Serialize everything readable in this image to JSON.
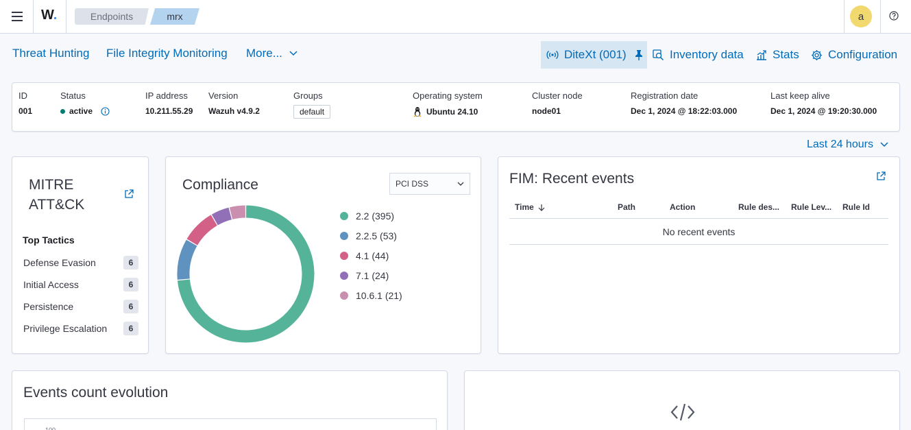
{
  "header": {
    "logo_text": "W",
    "breadcrumbs": [
      "Endpoints",
      "mrx"
    ],
    "avatar_letter": "a"
  },
  "nav": {
    "left": [
      "Threat Hunting",
      "File Integrity Monitoring",
      "More..."
    ],
    "agent_button": "DiteXt (001)",
    "right": [
      "Inventory data",
      "Stats",
      "Configuration"
    ]
  },
  "agent_info": {
    "id_label": "ID",
    "id": "001",
    "status_label": "Status",
    "status": "active",
    "ip_label": "IP address",
    "ip": "10.211.55.29",
    "version_label": "Version",
    "version": "Wazuh v4.9.2",
    "groups_label": "Groups",
    "group": "default",
    "os_label": "Operating system",
    "os": "Ubuntu 24.10",
    "cluster_label": "Cluster node",
    "cluster": "node01",
    "reg_label": "Registration date",
    "reg": "Dec 1, 2024 @ 18:22:03.000",
    "keepalive_label": "Last keep alive",
    "keepalive": "Dec 1, 2024 @ 19:20:30.000"
  },
  "time_range": "Last 24 hours",
  "mitre": {
    "title_line1": "MITRE",
    "title_line2": "ATT&CK",
    "subtitle": "Top Tactics",
    "tactics": [
      {
        "name": "Defense Evasion",
        "count": "6"
      },
      {
        "name": "Initial Access",
        "count": "6"
      },
      {
        "name": "Persistence",
        "count": "6"
      },
      {
        "name": "Privilege Escalation",
        "count": "6"
      }
    ]
  },
  "compliance": {
    "title": "Compliance",
    "selected": "PCI DSS"
  },
  "chart_data": {
    "type": "pie",
    "categories": [
      "2.2",
      "2.2.5",
      "4.1",
      "7.1",
      "10.6.1"
    ],
    "values": [
      395,
      53,
      44,
      24,
      21
    ],
    "legend": [
      "2.2 (395)",
      "2.2.5 (53)",
      "4.1 (44)",
      "7.1 (24)",
      "10.6.1 (21)"
    ],
    "colors": [
      "#54b399",
      "#6092c0",
      "#d36086",
      "#9170b8",
      "#ca8eae"
    ],
    "donut": true,
    "legend_position": "right"
  },
  "fim": {
    "title": "FIM: Recent events",
    "columns": [
      "Time",
      "Path",
      "Action",
      "Rule des...",
      "Rule Lev...",
      "Rule Id"
    ],
    "empty": "No recent events"
  },
  "events": {
    "title": "Events count evolution",
    "axis_tick": "100"
  },
  "colors": {
    "link": "#006bb8",
    "active": "#017d73",
    "agent_bg": "#d6e6f3"
  }
}
